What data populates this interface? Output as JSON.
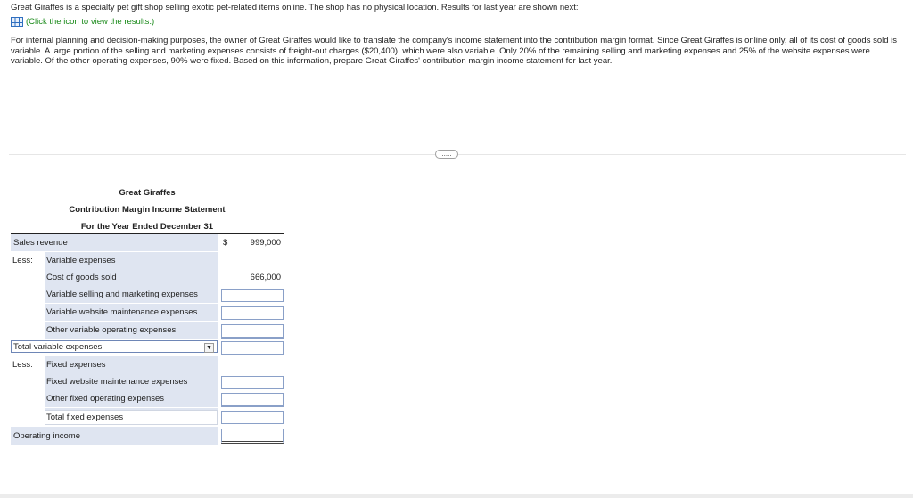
{
  "problem": {
    "intro": "Great Giraffes is a specialty pet gift shop selling exotic pet-related items online. The shop has no physical location. Results for last year are shown next:",
    "click_link": "(Click the icon to view the results.)",
    "paragraph": "For internal planning and decision-making purposes, the owner of Great Giraffes would like to translate the company's income statement into the contribution margin format. Since Great Giraffes is online only, all of its cost of goods sold is variable. A large portion of the selling and marketing expenses consists of freight-out charges ($20,400), which were also variable. Only 20% of the remaining selling and marketing expenses and 25% of the website expenses were variable. Of the other operating expenses, 90% were fixed. Based on this information, prepare Great Giraffes' contribution margin income statement for last year.",
    "more_button": "....."
  },
  "statement": {
    "company": "Great Giraffes",
    "title": "Contribution Margin Income Statement",
    "period": "For the Year Ended December 31",
    "rows": {
      "sales_revenue": {
        "label": "Sales revenue",
        "currency": "$",
        "value": "999,000"
      },
      "less_variable": {
        "prefix": "Less:",
        "label": "Variable expenses"
      },
      "cogs": {
        "label": "Cost of goods sold",
        "value": "666,000"
      },
      "var_selling": {
        "label": "Variable selling and marketing expenses",
        "value": ""
      },
      "var_website": {
        "label": "Variable website maintenance expenses",
        "value": ""
      },
      "other_var": {
        "label": "Other variable operating expenses",
        "value": ""
      },
      "total_variable": {
        "label": "Total variable expenses",
        "value": ""
      },
      "less_fixed": {
        "prefix": "Less:",
        "label": "Fixed expenses"
      },
      "fixed_website": {
        "label": "Fixed website maintenance expenses",
        "value": ""
      },
      "other_fixed": {
        "label": "Other fixed operating expenses",
        "value": ""
      },
      "total_fixed": {
        "label": "Total fixed expenses",
        "value": ""
      },
      "operating_income": {
        "label": "Operating income",
        "value": ""
      }
    }
  }
}
